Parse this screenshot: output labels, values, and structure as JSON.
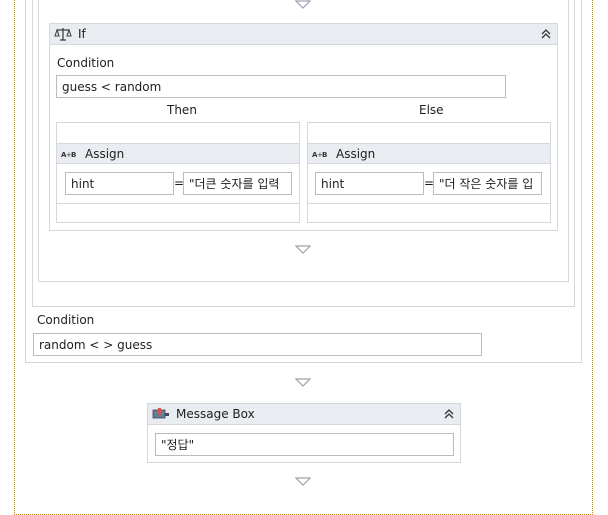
{
  "if_activity": {
    "title": "If",
    "condition_label": "Condition",
    "condition_value": "guess < random",
    "then_label": "Then",
    "else_label": "Else",
    "then_assign": {
      "title": "Assign",
      "to": "hint",
      "equals": "=",
      "value": "\"더큰 숫자를 입력"
    },
    "else_assign": {
      "title": "Assign",
      "to": "hint",
      "equals": "=",
      "value": "\"더 작은 숫자를 입"
    }
  },
  "do_while": {
    "condition_label": "Condition",
    "condition_value": "random < > guess"
  },
  "message_box": {
    "title": "Message Box",
    "text_value": "\"정답\""
  },
  "colors": {
    "header_bg": "#e9ecf0",
    "border": "#d4d7dc",
    "sequence_border": "#b98a1a",
    "arrow": "#9aa3ad"
  },
  "icons": {
    "if": "if-scale-icon",
    "assign": "assign-ab-icon",
    "message_box": "message-box-icon",
    "collapse": "double-chevron-up-icon",
    "drop": "drop-target-arrow-icon"
  }
}
